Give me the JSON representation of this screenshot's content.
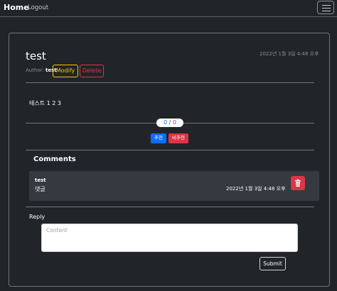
{
  "navbar": {
    "brand": "Home",
    "logout_label": "Logout",
    "menu_icon": "hamburger-menu-icon"
  },
  "post": {
    "title": "test",
    "date": "2022년 1월 3일 4:48 오후",
    "author_label": "Author:",
    "author_name": "test",
    "modify_label": "Modify",
    "delete_label": "Delete",
    "content": "테스트 1 2 3"
  },
  "votes": {
    "up_count": "0",
    "separator": "/",
    "down_count": "0",
    "recommend_label": "추천",
    "unrecommend_label": "비추천"
  },
  "comments": {
    "title": "Comments",
    "items": [
      {
        "author": "test",
        "text": "댓글",
        "date": "2022년 1월 3일 4:48 오후",
        "delete_icon": "trash-icon"
      }
    ]
  },
  "reply": {
    "label": "Reply",
    "placeholder": "Content",
    "submit_label": "Submit"
  },
  "colors": {
    "background": "#212529",
    "primary": "#0d6efd",
    "danger": "#dc3545",
    "warning": "#ffc107"
  }
}
